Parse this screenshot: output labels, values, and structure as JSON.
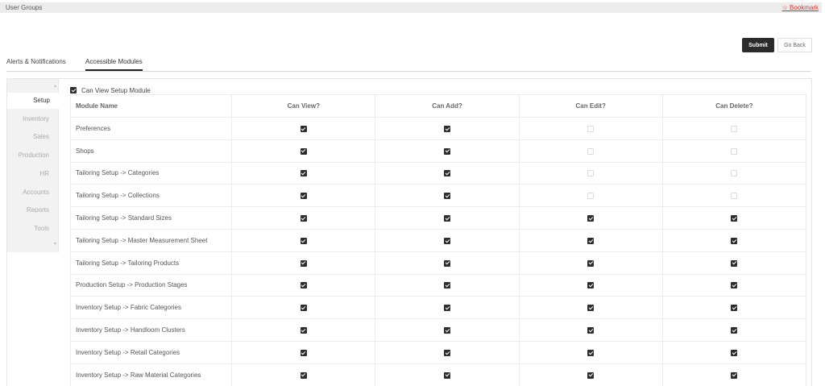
{
  "header": {
    "title": "User Groups",
    "bookmark_label": "☆ Bookmark"
  },
  "actions": {
    "submit_label": "Submit",
    "goback_label": "Go Back"
  },
  "tabs": [
    {
      "label": "Alerts & Notifications"
    },
    {
      "label": "Accessible Modules"
    }
  ],
  "sidenav": {
    "items": [
      {
        "label": "Setup"
      },
      {
        "label": "Inventory"
      },
      {
        "label": "Sales"
      },
      {
        "label": "Production"
      },
      {
        "label": "HR"
      },
      {
        "label": "Accounts"
      },
      {
        "label": "Reports"
      },
      {
        "label": "Tools"
      }
    ],
    "active_index": 0
  },
  "setup": {
    "can_view_label": "Can View Setup Module",
    "can_view_checked": true,
    "columns": [
      "Module Name",
      "Can View?",
      "Can Add?",
      "Can Edit?",
      "Can Delete?"
    ],
    "rows": [
      {
        "name": "Preferences",
        "view": true,
        "add": true,
        "edit": false,
        "delete": false
      },
      {
        "name": "Shops",
        "view": true,
        "add": true,
        "edit": false,
        "delete": false
      },
      {
        "name": "Tailoring Setup -> Categories",
        "view": true,
        "add": true,
        "edit": false,
        "delete": false
      },
      {
        "name": "Tailoring Setup -> Collections",
        "view": true,
        "add": true,
        "edit": false,
        "delete": false
      },
      {
        "name": "Tailoring Setup -> Standard Sizes",
        "view": true,
        "add": true,
        "edit": true,
        "delete": true
      },
      {
        "name": "Tailoring Setup -> Master Measurement Sheet",
        "view": true,
        "add": true,
        "edit": true,
        "delete": true
      },
      {
        "name": "Tailoring Setup -> Tailoring Products",
        "view": true,
        "add": true,
        "edit": true,
        "delete": true
      },
      {
        "name": "Production Setup -> Production Stages",
        "view": true,
        "add": true,
        "edit": true,
        "delete": true
      },
      {
        "name": "Inventory Setup -> Fabric Categories",
        "view": true,
        "add": true,
        "edit": true,
        "delete": true
      },
      {
        "name": "Inventory Setup -> Handloom Clusters",
        "view": true,
        "add": true,
        "edit": true,
        "delete": true
      },
      {
        "name": "Inventory Setup -> Retail Categories",
        "view": true,
        "add": true,
        "edit": true,
        "delete": true
      },
      {
        "name": "Inventory Setup -> Raw Material Categories",
        "view": true,
        "add": true,
        "edit": true,
        "delete": true
      }
    ]
  },
  "icons": {
    "star": "star-icon",
    "checkbox": "checkbox-icon",
    "scroll_up": "chevron-up-icon",
    "scroll_down": "chevron-down-icon"
  },
  "colors": {
    "bookmark": "#d9342b",
    "primary_button": "#2b2b2b",
    "checkbox_checked": "#2d2d2d"
  }
}
